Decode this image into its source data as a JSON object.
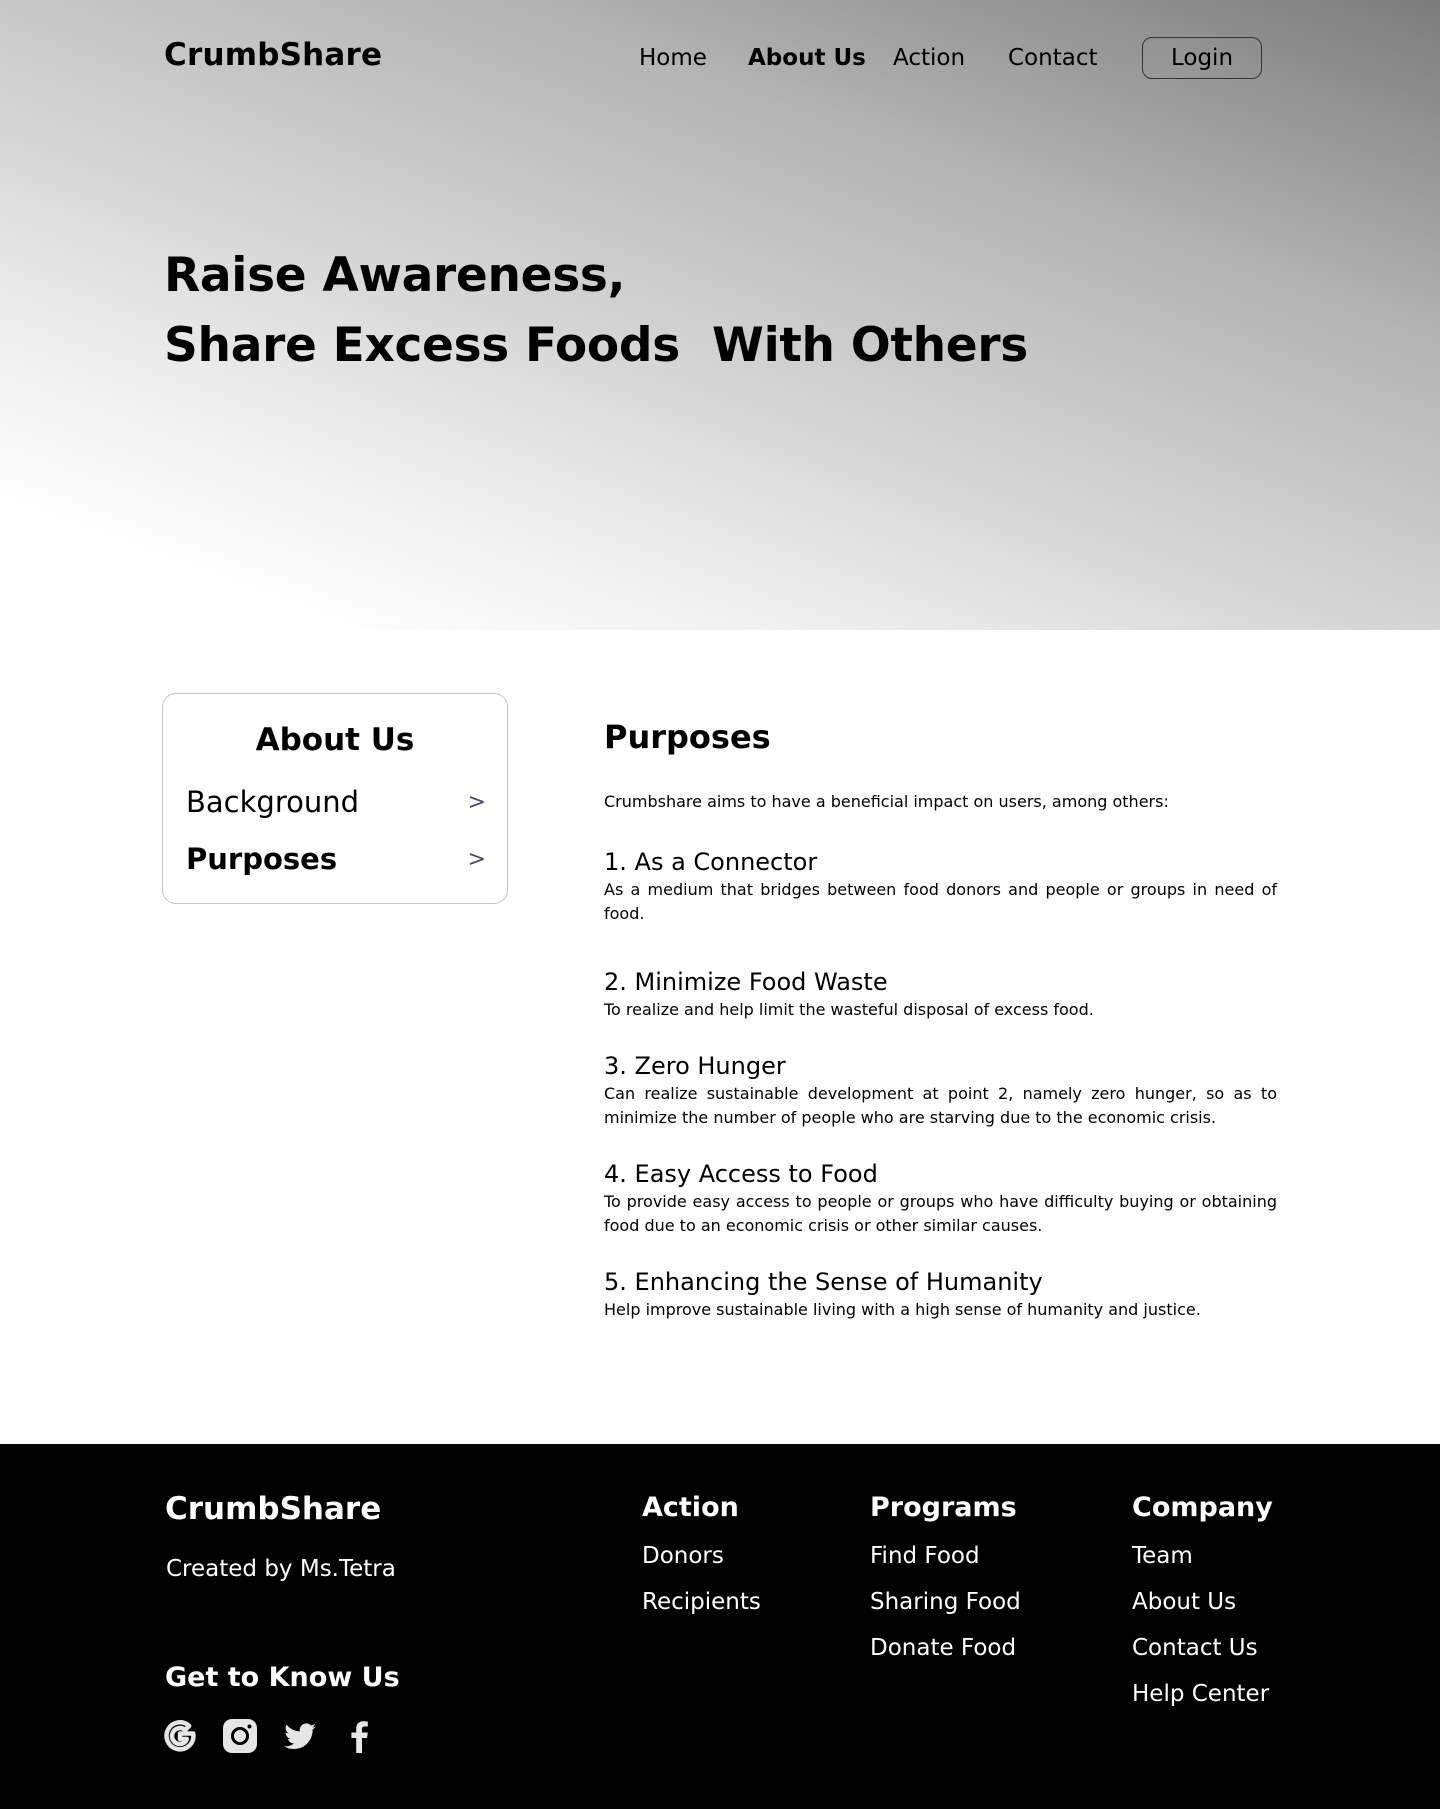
{
  "header": {
    "logo": "CrumbShare",
    "nav": [
      "Home",
      "About Us",
      "Action",
      "Contact"
    ],
    "login_label": "Login"
  },
  "hero": {
    "line1": "Raise Awareness,",
    "line2": "Share Excess Foods  With Others"
  },
  "sidebar": {
    "title": "About Us",
    "items": [
      {
        "label": "Background",
        "chevron": ">"
      },
      {
        "label": "Purposes",
        "chevron": ">"
      }
    ]
  },
  "main": {
    "title": "Purposes",
    "intro": "Crumbshare aims to have a beneficial impact on users, among others:",
    "purposes": [
      {
        "title": "1. As a Connector",
        "text": "As a medium that bridges between food donors and people or groups in need of food."
      },
      {
        "title": "2. Minimize Food Waste",
        "text": "To realize and help limit the wasteful disposal of excess food."
      },
      {
        "title": "3. Zero Hunger",
        "text": "Can realize sustainable development at point 2, namely zero hunger, so as to minimize the number of people who are starving due to the economic crisis."
      },
      {
        "title": "4. Easy Access to Food",
        "text": "To provide easy access to people or groups who have difficulty buying or obtaining food due to an economic crisis or other similar causes."
      },
      {
        "title": "5. Enhancing the Sense of Humanity",
        "text": "Help improve sustainable living with a high sense of humanity and justice."
      }
    ]
  },
  "footer": {
    "logo": "CrumbShare",
    "created_by": "Created by Ms.Tetra",
    "know_us": "Get to Know Us",
    "socials": [
      "google-icon",
      "instagram-icon",
      "twitter-icon",
      "facebook-icon"
    ],
    "columns": [
      {
        "title": "Action",
        "links": [
          "Donors",
          "Recipients"
        ]
      },
      {
        "title": "Programs",
        "links": [
          "Find Food",
          "Sharing Food",
          "Donate Food"
        ]
      },
      {
        "title": "Company",
        "links": [
          "Team",
          "About Us",
          "Contact Us",
          "Help Center"
        ]
      }
    ]
  },
  "colors": {
    "footer_bg": "#000000",
    "hero_gradient_dark": "#7c7c7c",
    "hero_gradient_light": "#ffffff"
  }
}
